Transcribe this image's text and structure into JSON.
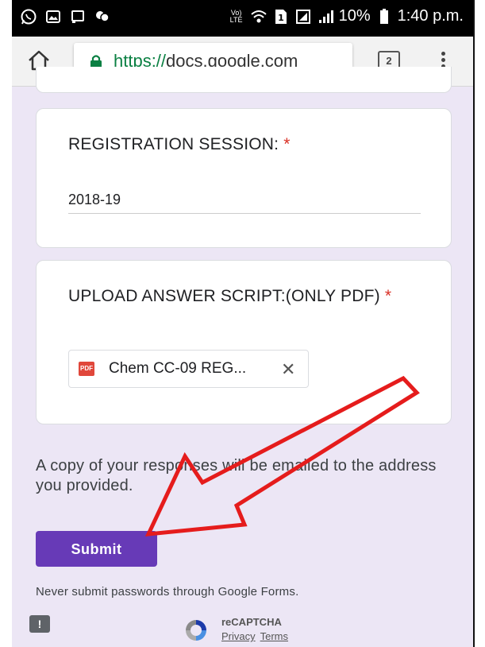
{
  "statusbar": {
    "left_icons": [
      "whatsapp-icon",
      "gallery-icon",
      "cast-icon",
      "chat-icon"
    ],
    "battery": "10%",
    "time": "1:40 p.m.",
    "volte": "Vo) LTE"
  },
  "browser": {
    "url_scheme": "https://",
    "url_host": "docs.google.com",
    "tab_count": "2"
  },
  "form": {
    "session_title": "REGISTRATION SESSION:",
    "session_required": "*",
    "session_value": "2018-19",
    "upload_title": "UPLOAD ANSWER SCRIPT:(ONLY PDF)",
    "upload_required": "*",
    "file_icon_label": "PDF",
    "file_name": "Chem CC-09 REG...",
    "file_remove": "✕",
    "copy_notice": "A copy of your responses will be emailed to the address you provided.",
    "submit_label": "Submit",
    "warning": "Never submit passwords through Google Forms."
  },
  "footer": {
    "feedback_label": "!",
    "recaptcha_label": "reCAPTCHA",
    "privacy_label": "Privacy",
    "terms_label": "Terms"
  },
  "colors": {
    "accent": "#673ab7",
    "background": "#ece6f5",
    "required": "#d93025",
    "annotation_arrow": "#e51c1c"
  }
}
